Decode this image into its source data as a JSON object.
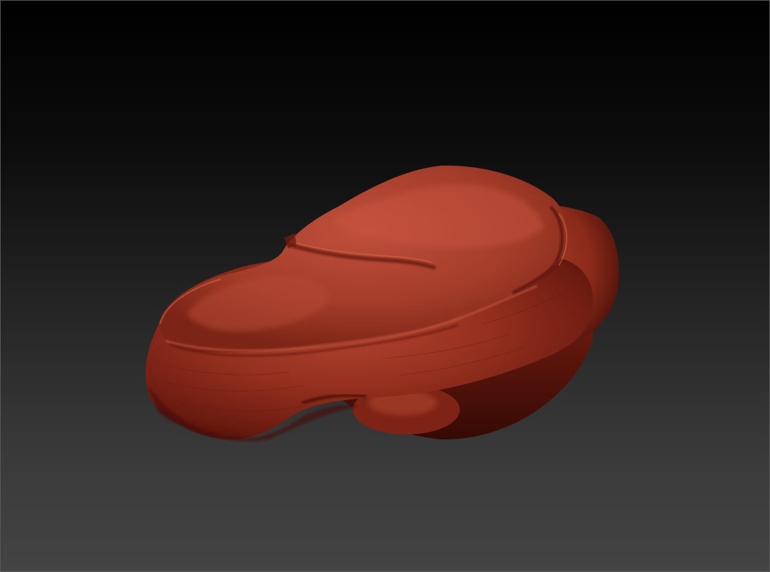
{
  "viewport": {
    "bg_top": "#000000",
    "bg_bottom": "#444444",
    "border_color": "#5a5a5a"
  },
  "model": {
    "material_color": "#8e2a1c",
    "highlight_color": "#c2503b",
    "shadow_color": "#3f0d06"
  }
}
